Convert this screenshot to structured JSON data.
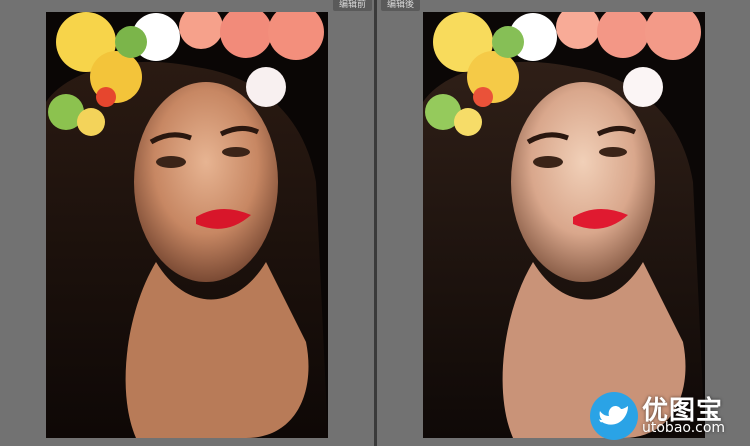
{
  "before_panel": {
    "tab_label": "编辑前",
    "photo_alt": "portrait-before-edit"
  },
  "after_panel": {
    "tab_label": "编辑後",
    "photo_alt": "portrait-after-edit"
  },
  "watermark": {
    "brand_cn": "优图宝",
    "brand_en": "utobao.com"
  },
  "colors": {
    "panel_bg": "#727272",
    "divider": "#3a3a3a",
    "tab_bg": "#5a5a5a",
    "watermark_blue": "#2aa3e6"
  }
}
